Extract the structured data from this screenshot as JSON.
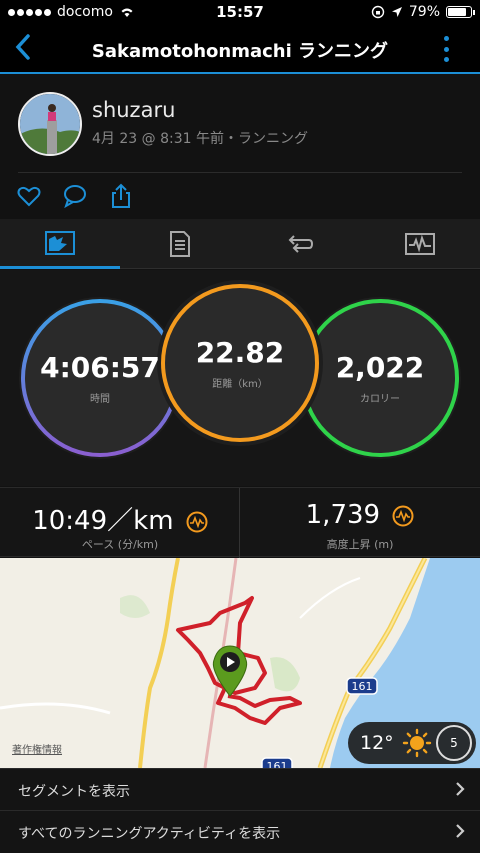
{
  "status_bar": {
    "carrier": "docomo",
    "time": "15:57",
    "battery": "79%"
  },
  "nav": {
    "title": "Sakamotohonmachi ランニング"
  },
  "profile": {
    "username": "shuzaru",
    "subtitle": "4月 23 @ 8:31 午前・ランニング"
  },
  "rings": {
    "time": {
      "value": "4:06:57",
      "label": "時間"
    },
    "distance": {
      "value": "22.82",
      "label": "距離（km）"
    },
    "calories": {
      "value": "2,022",
      "label": "カロリー"
    }
  },
  "stats": {
    "pace": {
      "value": "10:49／km",
      "label": "ペース (分/km)"
    },
    "elevation": {
      "value": "1,739",
      "label": "高度上昇 (m)"
    }
  },
  "map": {
    "attribution": "著作権情報",
    "route_shield": "161",
    "route_shield_2": "161"
  },
  "weather": {
    "temperature": "12°",
    "wind": "5"
  },
  "rows": [
    {
      "label": "セグメントを表示"
    },
    {
      "label": "すべてのランニングアクティビティを表示"
    }
  ],
  "colors": {
    "accent": "#1c8fd6",
    "ring_time": "#7a6fd6",
    "ring_distance": "#f39a1e",
    "ring_calories": "#2fd34a",
    "route": "#d0202a"
  }
}
